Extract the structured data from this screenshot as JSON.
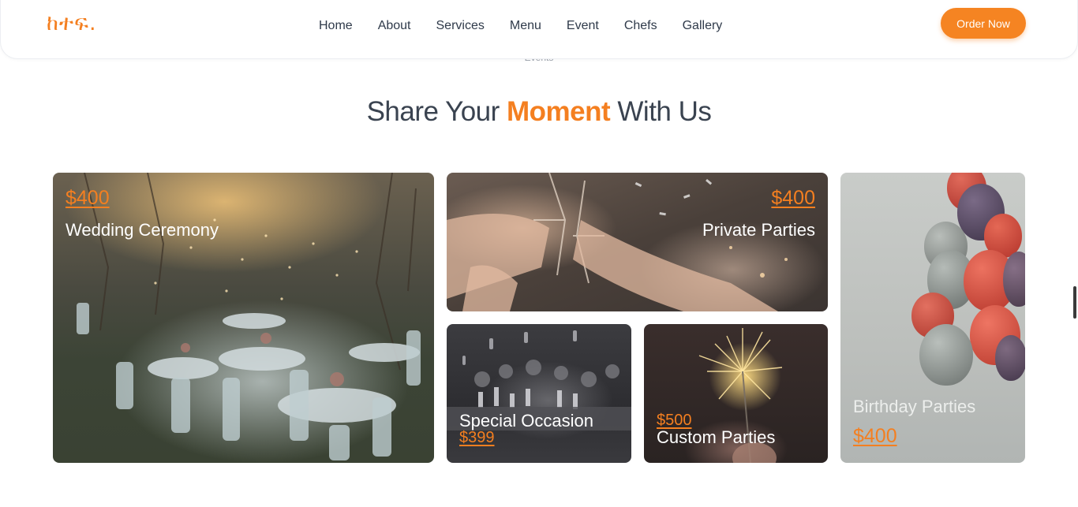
{
  "header": {
    "logo": "ከተፍ.",
    "nav": [
      "Home",
      "About",
      "Services",
      "Menu",
      "Event",
      "Chefs",
      "Gallery"
    ],
    "order_button": "Order Now"
  },
  "section": {
    "tag": "Events",
    "title_pre": "Share Your ",
    "title_accent": "Moment",
    "title_post": " With Us"
  },
  "events": {
    "wedding": {
      "title": "Wedding Ceremony",
      "price": "$400"
    },
    "private": {
      "title": "Private Parties",
      "price": "$400"
    },
    "special": {
      "title": "Special Occasion",
      "price": "$399"
    },
    "custom": {
      "title": "Custom Parties",
      "price": "$500"
    },
    "birthday": {
      "title": "Birthday Parties",
      "price": "$400"
    }
  },
  "colors": {
    "accent": "#f47f20",
    "text_dark": "#3a4350"
  }
}
